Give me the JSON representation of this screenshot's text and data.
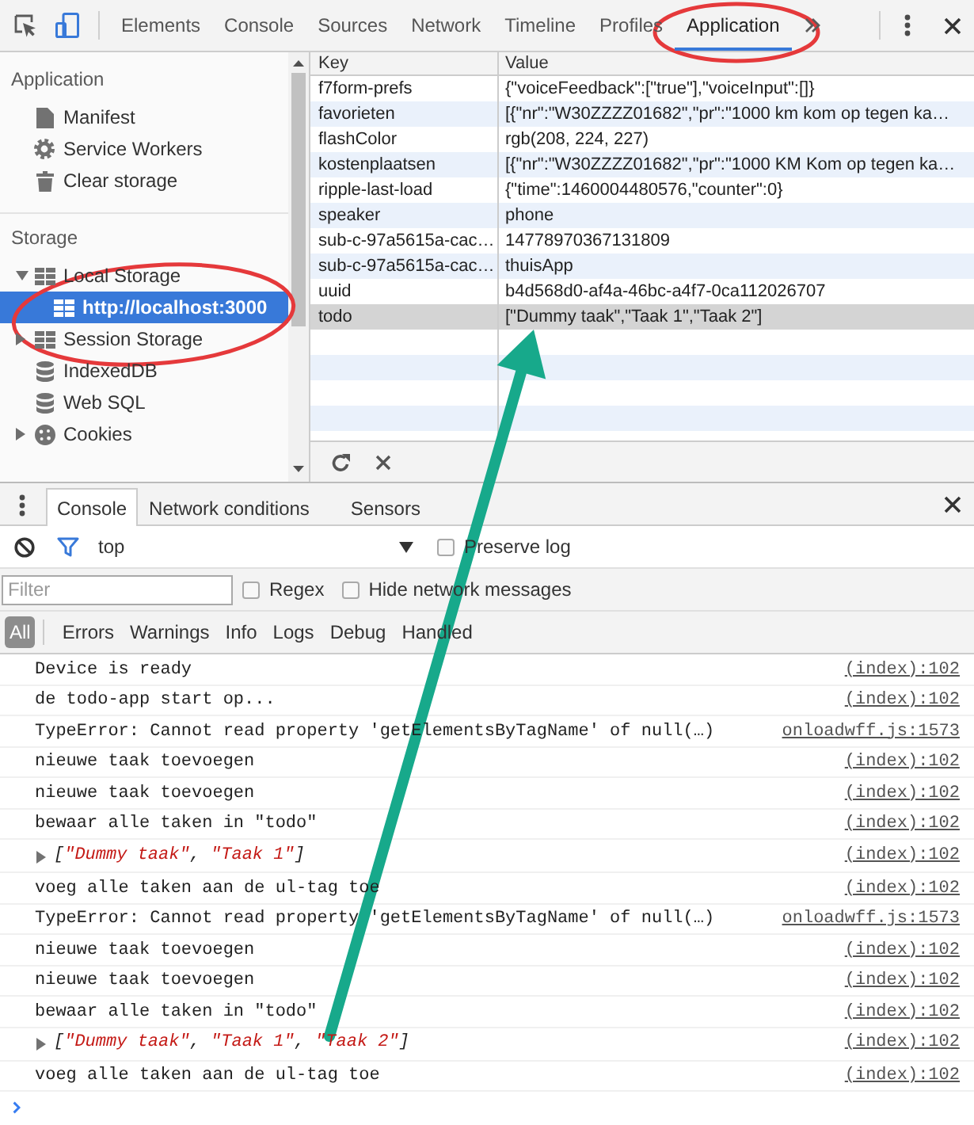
{
  "toolbar": {
    "device_mode": true,
    "tabs": [
      {
        "label": "Elements",
        "selected": false
      },
      {
        "label": "Console",
        "selected": false
      },
      {
        "label": "Sources",
        "selected": false
      },
      {
        "label": "Network",
        "selected": false
      },
      {
        "label": "Timeline",
        "selected": false
      },
      {
        "label": "Profiles",
        "selected": false
      },
      {
        "label": "Application",
        "selected": true
      }
    ]
  },
  "sidebar": {
    "sections": [
      {
        "title": "Application",
        "items": [
          {
            "label": "Manifest",
            "kind": "manifest",
            "selected": false
          },
          {
            "label": "Service Workers",
            "kind": "workers",
            "selected": false
          },
          {
            "label": "Clear storage",
            "kind": "clear",
            "selected": false
          }
        ]
      },
      {
        "title": "Storage",
        "items": [
          {
            "label": "Local Storage",
            "kind": "storage",
            "selected": false,
            "expanded": true,
            "children": [
              {
                "label": "http://localhost:3000",
                "kind": "storage",
                "selected": true
              }
            ]
          },
          {
            "label": "Session Storage",
            "kind": "storage",
            "selected": false,
            "expanded": false
          },
          {
            "label": "IndexedDB",
            "kind": "database",
            "selected": false
          },
          {
            "label": "Web SQL",
            "kind": "database",
            "selected": false
          },
          {
            "label": "Cookies",
            "kind": "cookies",
            "selected": false,
            "expanded": false
          }
        ]
      }
    ]
  },
  "storage_table": {
    "columns": [
      "Key",
      "Value"
    ],
    "rows": [
      {
        "key": "f7form-prefs",
        "value": "{\"voiceFeedback\":[\"true\"],\"voiceInput\":[]}",
        "selected": false
      },
      {
        "key": "favorieten",
        "value": "[{\"nr\":\"W30ZZZZ01682\",\"pr\":\"1000 km kom op tegen ka…",
        "selected": false
      },
      {
        "key": "flashColor",
        "value": "rgb(208, 224, 227)",
        "selected": false
      },
      {
        "key": "kostenplaatsen",
        "value": "[{\"nr\":\"W30ZZZZ01682\",\"pr\":\"1000 KM Kom op tegen ka…",
        "selected": false
      },
      {
        "key": "ripple-last-load",
        "value": "{\"time\":1460004480576,\"counter\":0}",
        "selected": false
      },
      {
        "key": "speaker",
        "value": "phone",
        "selected": false
      },
      {
        "key": "sub-c-97a5615a-cac…",
        "value": "14778970367131809",
        "selected": false
      },
      {
        "key": "sub-c-97a5615a-cac…",
        "value": "thuisApp",
        "selected": false
      },
      {
        "key": "uuid",
        "value": "b4d568d0-af4a-46bc-a4f7-0ca112026707",
        "selected": false
      },
      {
        "key": "todo",
        "value": "[\"Dummy taak\",\"Taak 1\",\"Taak 2\"]",
        "selected": true
      }
    ]
  },
  "drawer": {
    "tabs": [
      {
        "label": "Console",
        "selected": true
      },
      {
        "label": "Network conditions",
        "selected": false
      },
      {
        "label": "Sensors",
        "selected": false
      }
    ],
    "filter_on": true,
    "context": "top",
    "preserve_log": {
      "label": "Preserve log",
      "checked": false
    },
    "filter": {
      "placeholder": "Filter"
    },
    "options": [
      {
        "label": "Regex",
        "checked": false
      },
      {
        "label": "Hide network messages",
        "checked": false
      }
    ],
    "levels": [
      {
        "label": "All",
        "selected": true
      },
      {
        "label": "Errors",
        "selected": false
      },
      {
        "label": "Warnings",
        "selected": false
      },
      {
        "label": "Info",
        "selected": false
      },
      {
        "label": "Logs",
        "selected": false
      },
      {
        "label": "Debug",
        "selected": false
      },
      {
        "label": "Handled",
        "selected": false
      }
    ],
    "messages": [
      {
        "kind": "text",
        "text": "Device is ready",
        "source": "(index):102"
      },
      {
        "kind": "text",
        "text": "de todo-app start op...",
        "source": "(index):102"
      },
      {
        "kind": "text",
        "text": "TypeError: Cannot read property 'getElementsByTagName' of null(…)",
        "source": "onloadwff.js:1573"
      },
      {
        "kind": "text",
        "text": "nieuwe taak toevoegen",
        "source": "(index):102"
      },
      {
        "kind": "text",
        "text": "nieuwe taak toevoegen",
        "source": "(index):102"
      },
      {
        "kind": "text",
        "text": "bewaar alle taken in \"todo\"",
        "source": "(index):102"
      },
      {
        "kind": "object",
        "text": "[\"Dummy taak\", \"Taak 1\"]",
        "expanded": false,
        "source": "(index):102"
      },
      {
        "kind": "text",
        "text": "voeg alle taken aan de ul-tag toe",
        "source": "(index):102"
      },
      {
        "kind": "text",
        "text": "TypeError: Cannot read property 'getElementsByTagName' of null(…)",
        "source": "onloadwff.js:1573"
      },
      {
        "kind": "text",
        "text": "nieuwe taak toevoegen",
        "source": "(index):102"
      },
      {
        "kind": "text",
        "text": "nieuwe taak toevoegen",
        "source": "(index):102"
      },
      {
        "kind": "text",
        "text": "bewaar alle taken in \"todo\"",
        "source": "(index):102"
      },
      {
        "kind": "object",
        "text": "[\"Dummy taak\", \"Taak 1\", \"Taak 2\"]",
        "expanded": false,
        "source": "(index):102"
      },
      {
        "kind": "text",
        "text": "voeg alle taken aan de ul-tag toe",
        "source": "(index):102"
      }
    ]
  }
}
